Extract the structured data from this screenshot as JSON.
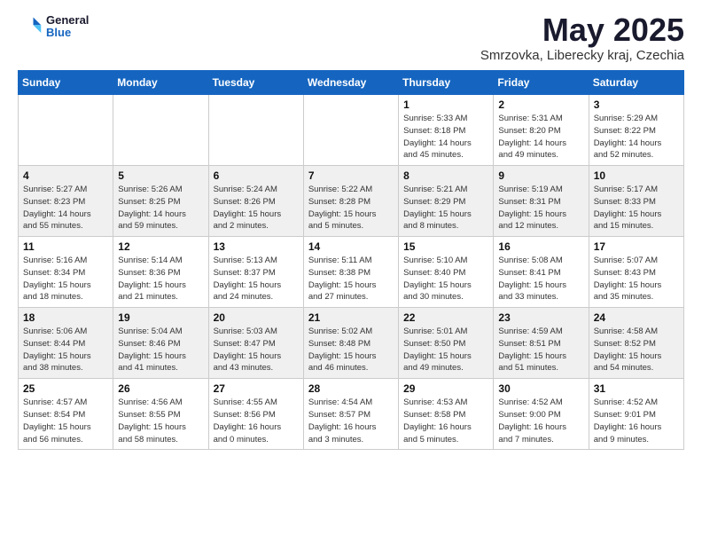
{
  "header": {
    "logo_line1": "General",
    "logo_line2": "Blue",
    "month_year": "May 2025",
    "location": "Smrzovka, Liberecky kraj, Czechia"
  },
  "days_of_week": [
    "Sunday",
    "Monday",
    "Tuesday",
    "Wednesday",
    "Thursday",
    "Friday",
    "Saturday"
  ],
  "weeks": [
    [
      {
        "num": "",
        "detail": ""
      },
      {
        "num": "",
        "detail": ""
      },
      {
        "num": "",
        "detail": ""
      },
      {
        "num": "",
        "detail": ""
      },
      {
        "num": "1",
        "detail": "Sunrise: 5:33 AM\nSunset: 8:18 PM\nDaylight: 14 hours\nand 45 minutes."
      },
      {
        "num": "2",
        "detail": "Sunrise: 5:31 AM\nSunset: 8:20 PM\nDaylight: 14 hours\nand 49 minutes."
      },
      {
        "num": "3",
        "detail": "Sunrise: 5:29 AM\nSunset: 8:22 PM\nDaylight: 14 hours\nand 52 minutes."
      }
    ],
    [
      {
        "num": "4",
        "detail": "Sunrise: 5:27 AM\nSunset: 8:23 PM\nDaylight: 14 hours\nand 55 minutes."
      },
      {
        "num": "5",
        "detail": "Sunrise: 5:26 AM\nSunset: 8:25 PM\nDaylight: 14 hours\nand 59 minutes."
      },
      {
        "num": "6",
        "detail": "Sunrise: 5:24 AM\nSunset: 8:26 PM\nDaylight: 15 hours\nand 2 minutes."
      },
      {
        "num": "7",
        "detail": "Sunrise: 5:22 AM\nSunset: 8:28 PM\nDaylight: 15 hours\nand 5 minutes."
      },
      {
        "num": "8",
        "detail": "Sunrise: 5:21 AM\nSunset: 8:29 PM\nDaylight: 15 hours\nand 8 minutes."
      },
      {
        "num": "9",
        "detail": "Sunrise: 5:19 AM\nSunset: 8:31 PM\nDaylight: 15 hours\nand 12 minutes."
      },
      {
        "num": "10",
        "detail": "Sunrise: 5:17 AM\nSunset: 8:33 PM\nDaylight: 15 hours\nand 15 minutes."
      }
    ],
    [
      {
        "num": "11",
        "detail": "Sunrise: 5:16 AM\nSunset: 8:34 PM\nDaylight: 15 hours\nand 18 minutes."
      },
      {
        "num": "12",
        "detail": "Sunrise: 5:14 AM\nSunset: 8:36 PM\nDaylight: 15 hours\nand 21 minutes."
      },
      {
        "num": "13",
        "detail": "Sunrise: 5:13 AM\nSunset: 8:37 PM\nDaylight: 15 hours\nand 24 minutes."
      },
      {
        "num": "14",
        "detail": "Sunrise: 5:11 AM\nSunset: 8:38 PM\nDaylight: 15 hours\nand 27 minutes."
      },
      {
        "num": "15",
        "detail": "Sunrise: 5:10 AM\nSunset: 8:40 PM\nDaylight: 15 hours\nand 30 minutes."
      },
      {
        "num": "16",
        "detail": "Sunrise: 5:08 AM\nSunset: 8:41 PM\nDaylight: 15 hours\nand 33 minutes."
      },
      {
        "num": "17",
        "detail": "Sunrise: 5:07 AM\nSunset: 8:43 PM\nDaylight: 15 hours\nand 35 minutes."
      }
    ],
    [
      {
        "num": "18",
        "detail": "Sunrise: 5:06 AM\nSunset: 8:44 PM\nDaylight: 15 hours\nand 38 minutes."
      },
      {
        "num": "19",
        "detail": "Sunrise: 5:04 AM\nSunset: 8:46 PM\nDaylight: 15 hours\nand 41 minutes."
      },
      {
        "num": "20",
        "detail": "Sunrise: 5:03 AM\nSunset: 8:47 PM\nDaylight: 15 hours\nand 43 minutes."
      },
      {
        "num": "21",
        "detail": "Sunrise: 5:02 AM\nSunset: 8:48 PM\nDaylight: 15 hours\nand 46 minutes."
      },
      {
        "num": "22",
        "detail": "Sunrise: 5:01 AM\nSunset: 8:50 PM\nDaylight: 15 hours\nand 49 minutes."
      },
      {
        "num": "23",
        "detail": "Sunrise: 4:59 AM\nSunset: 8:51 PM\nDaylight: 15 hours\nand 51 minutes."
      },
      {
        "num": "24",
        "detail": "Sunrise: 4:58 AM\nSunset: 8:52 PM\nDaylight: 15 hours\nand 54 minutes."
      }
    ],
    [
      {
        "num": "25",
        "detail": "Sunrise: 4:57 AM\nSunset: 8:54 PM\nDaylight: 15 hours\nand 56 minutes."
      },
      {
        "num": "26",
        "detail": "Sunrise: 4:56 AM\nSunset: 8:55 PM\nDaylight: 15 hours\nand 58 minutes."
      },
      {
        "num": "27",
        "detail": "Sunrise: 4:55 AM\nSunset: 8:56 PM\nDaylight: 16 hours\nand 0 minutes."
      },
      {
        "num": "28",
        "detail": "Sunrise: 4:54 AM\nSunset: 8:57 PM\nDaylight: 16 hours\nand 3 minutes."
      },
      {
        "num": "29",
        "detail": "Sunrise: 4:53 AM\nSunset: 8:58 PM\nDaylight: 16 hours\nand 5 minutes."
      },
      {
        "num": "30",
        "detail": "Sunrise: 4:52 AM\nSunset: 9:00 PM\nDaylight: 16 hours\nand 7 minutes."
      },
      {
        "num": "31",
        "detail": "Sunrise: 4:52 AM\nSunset: 9:01 PM\nDaylight: 16 hours\nand 9 minutes."
      }
    ]
  ]
}
